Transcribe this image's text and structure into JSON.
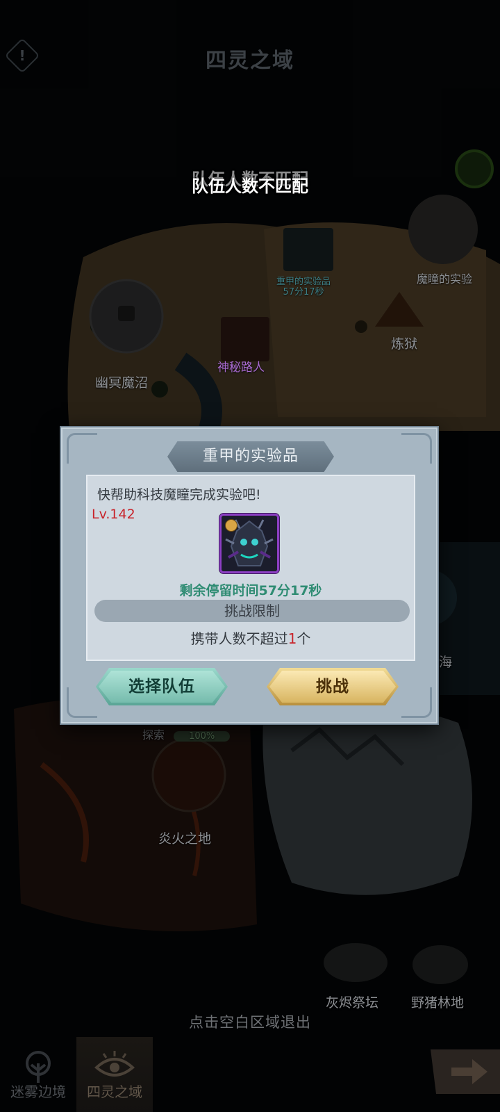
{
  "header": {
    "title": "四灵之域",
    "info_icon": "!"
  },
  "toast": {
    "message": "队伍人数不匹配"
  },
  "map": {
    "locations": {
      "swamp": "幽冥魔沼",
      "mystery": "神秘路人",
      "boss_node": "重甲的实验品",
      "boss_timer": "57分17秒",
      "experiment": "魔瞳的实验",
      "purgatory": "炼狱",
      "sea": "海",
      "fire": "炎火之地",
      "explore": "探索",
      "explore_pct": "100%",
      "ash_altar": "灰烬祭坛",
      "boar_forest": "野猪林地"
    },
    "exit_hint": "点击空白区域退出"
  },
  "tabs": [
    {
      "label": "迷雾边境",
      "active": false
    },
    {
      "label": "四灵之域",
      "active": true
    }
  ],
  "dialog": {
    "title": "重甲的实验品",
    "description": "快帮助科技魔瞳完成实验吧!",
    "level": "Lv.142",
    "timer": "剩余停留时间57分17秒",
    "limit_title": "挑战限制",
    "limit_prefix": "携带人数不超过",
    "limit_count": "1",
    "limit_suffix": "个",
    "team_button": "选择队伍",
    "fight_button": "挑战"
  },
  "colors": {
    "level_red": "#c8232a",
    "timer_green": "#2f8c73",
    "team_button": "#76bcad",
    "fight_button": "#d8b561"
  }
}
